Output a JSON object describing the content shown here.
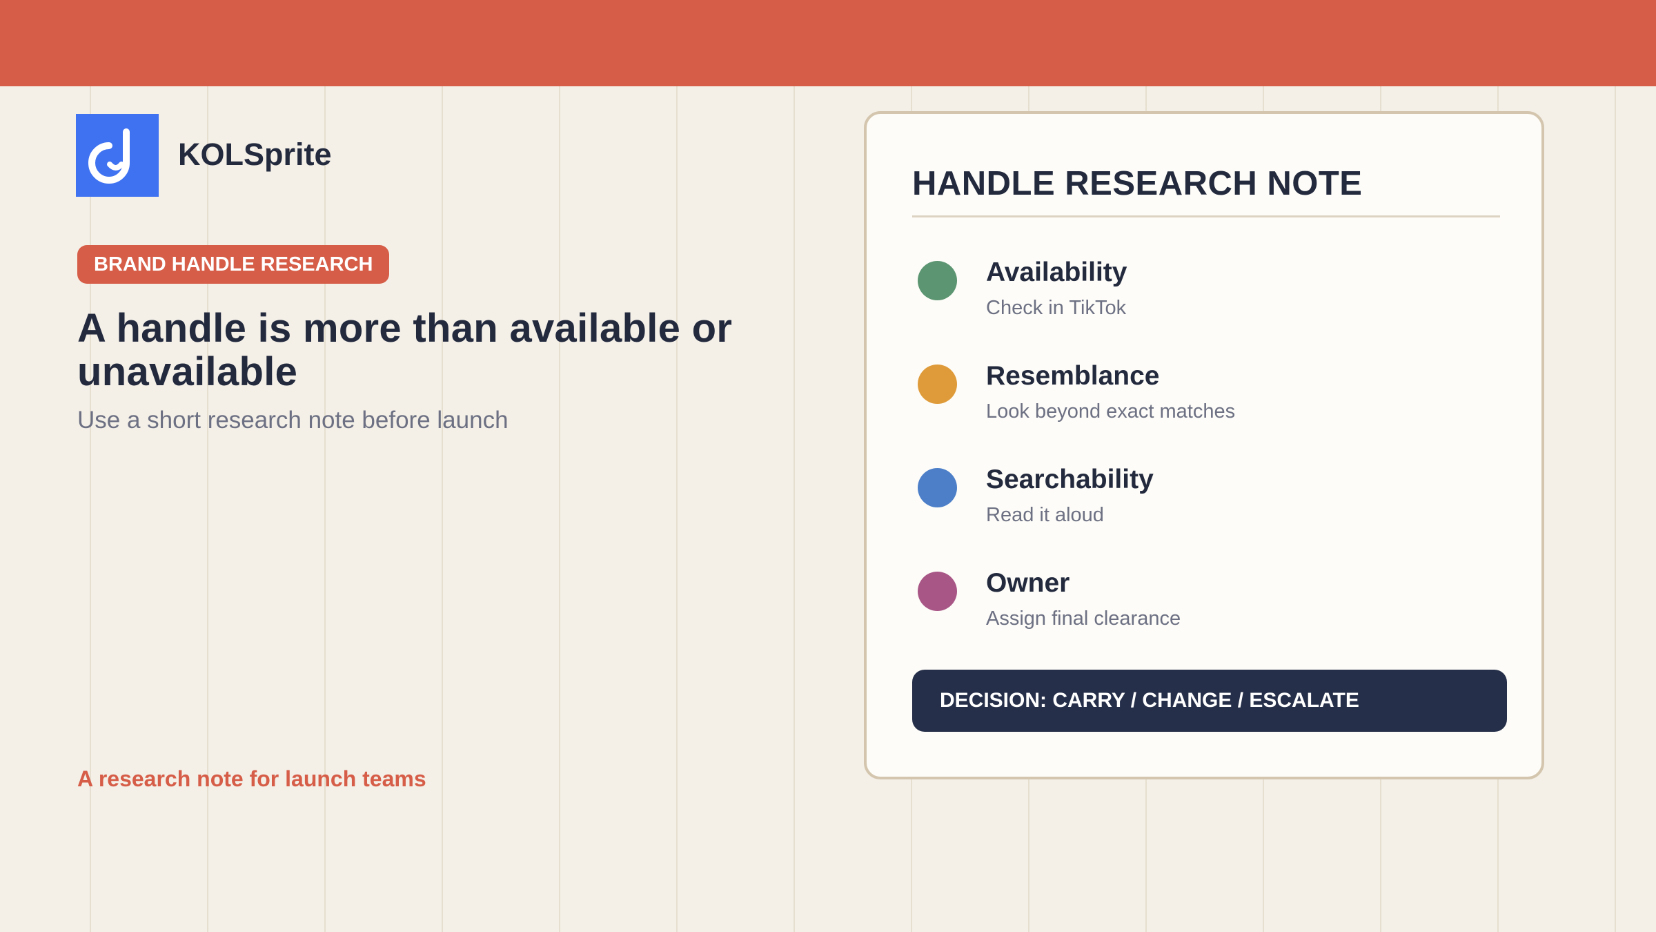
{
  "brand": {
    "name": "KOLSprite",
    "logo_icon": "kolsprite-logo-icon",
    "logo_color": "#3f72f0"
  },
  "hero": {
    "tag": "BRAND HANDLE RESEARCH",
    "headline": "A handle is more than available or unavailable",
    "subhead": "Use a short research note before launch"
  },
  "footer": {
    "note": "A research note for launch teams"
  },
  "note_card": {
    "title": "HANDLE RESEARCH NOTE",
    "criteria": [
      {
        "label": "Availability",
        "desc": "Check in TikTok",
        "color": "#5c9571"
      },
      {
        "label": "Resemblance",
        "desc": "Look beyond exact matches",
        "color": "#df9b3a"
      },
      {
        "label": "Searchability",
        "desc": "Read it aloud",
        "color": "#4c7fc8"
      },
      {
        "label": "Owner",
        "desc": "Assign final clearance",
        "color": "#a85686"
      }
    ],
    "decision": "DECISION: CARRY / CHANGE / ESCALATE"
  },
  "colors": {
    "accent": "#d65d47",
    "background": "#f4f0e8",
    "ink": "#232a3e",
    "decision_bg": "#262f49"
  }
}
